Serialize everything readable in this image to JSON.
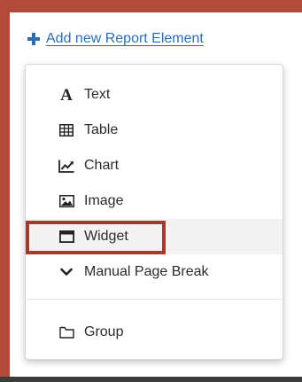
{
  "add_link": {
    "label": "Add new Report Element",
    "icon": "plus-icon"
  },
  "menu": {
    "items": [
      {
        "label": "Text",
        "icon": "text-format-icon"
      },
      {
        "label": "Table",
        "icon": "table-icon"
      },
      {
        "label": "Chart",
        "icon": "line-chart-icon"
      },
      {
        "label": "Image",
        "icon": "image-icon"
      },
      {
        "label": "Widget",
        "icon": "window-icon"
      },
      {
        "label": "Manual Page Break",
        "icon": "chevron-down-icon"
      },
      {
        "label": "Group",
        "icon": "folder-icon"
      }
    ]
  },
  "colors": {
    "link": "#2a6fb8",
    "highlight": "#a63a2e",
    "frame": "#b24a3a"
  }
}
